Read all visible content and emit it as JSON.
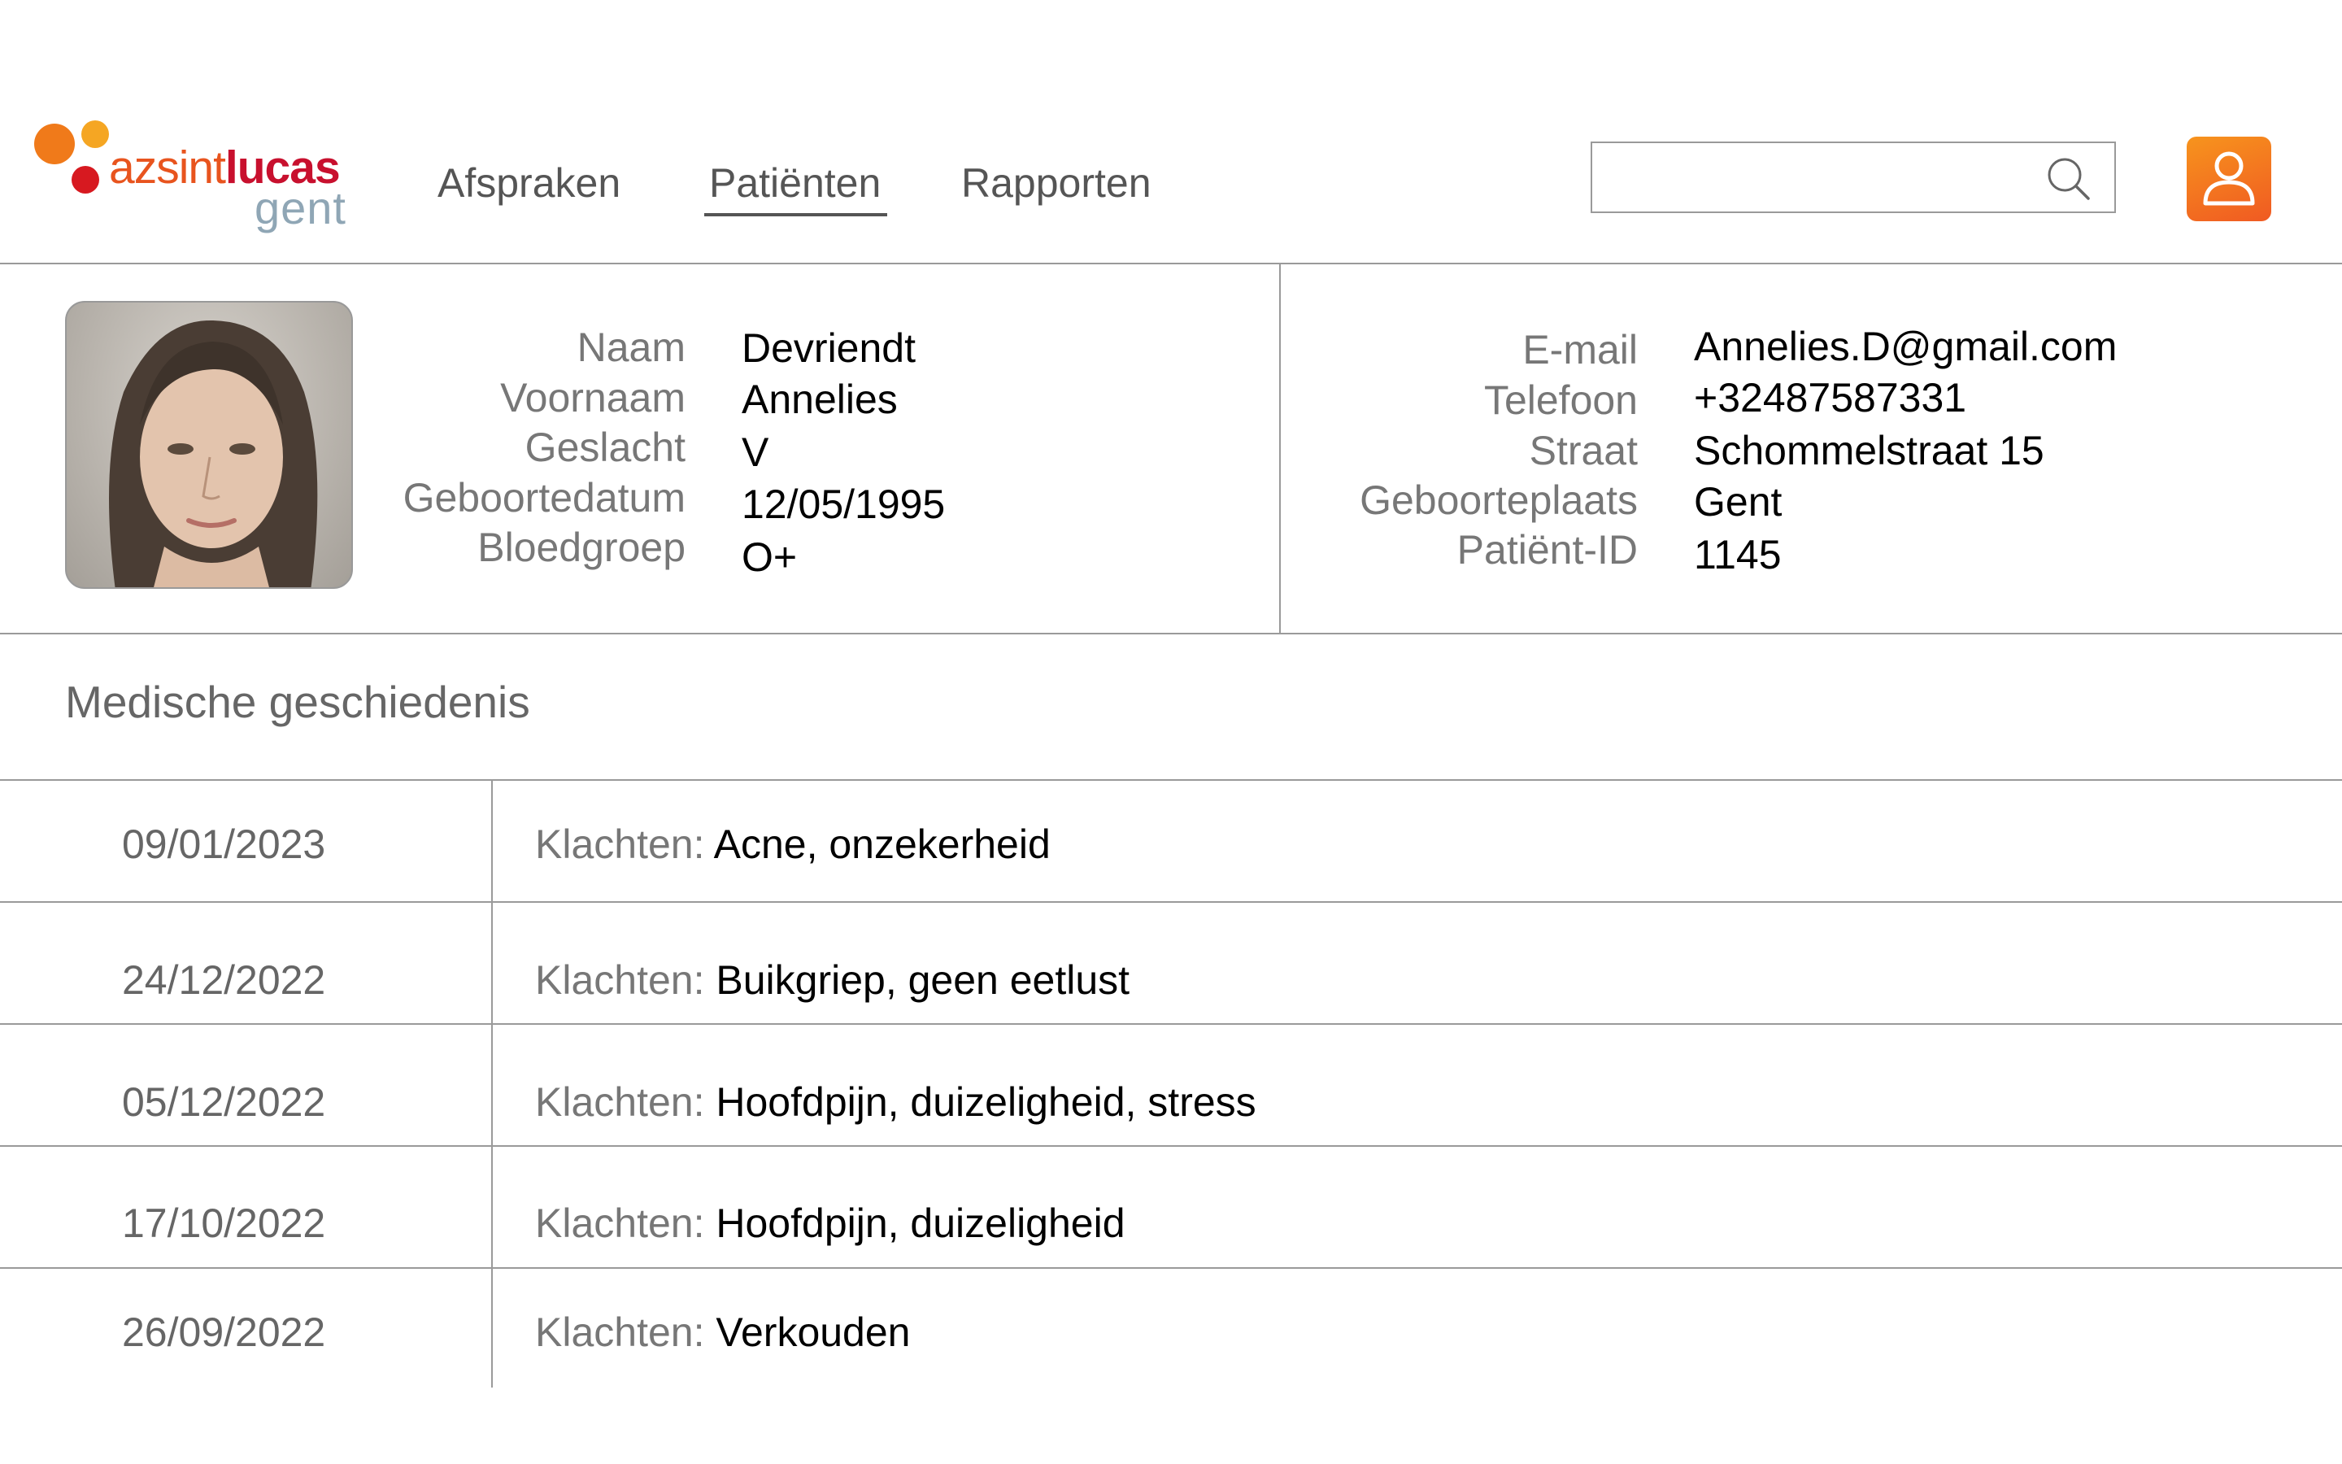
{
  "header": {
    "logo": {
      "part1": "az",
      "part2": "sint",
      "part3": "lucas",
      "city": "gent"
    },
    "nav": [
      {
        "label": "Afspraken",
        "active": false
      },
      {
        "label": "Patiënten",
        "active": true
      },
      {
        "label": "Rapporten",
        "active": false
      }
    ],
    "search": {
      "value": "",
      "placeholder": "",
      "icon": "search-icon"
    },
    "user_icon": "user-icon"
  },
  "patient": {
    "left_labels": [
      "Naam",
      "Voornaam",
      "Geslacht",
      "Geboortedatum",
      "Bloedgroep"
    ],
    "left_values": [
      "Devriendt",
      "Annelies",
      "V",
      "12/05/1995",
      "O+"
    ],
    "right_labels": [
      "E-mail",
      "Telefoon",
      "Straat",
      "Geboorteplaats",
      "Patiënt-ID"
    ],
    "right_values": [
      "Annelies.D@gmail.com",
      "+32487587331",
      "Schommelstraat 15",
      "Gent",
      "1145"
    ]
  },
  "history": {
    "title": "Medische geschiedenis",
    "complaint_label": "Klachten:",
    "rows": [
      {
        "date": "09/01/2023",
        "complaint": "Acne, onzekerheid"
      },
      {
        "date": "24/12/2022",
        "complaint": "Buikgriep, geen eetlust"
      },
      {
        "date": "05/12/2022",
        "complaint": "Hoofdpijn, duizeligheid, stress"
      },
      {
        "date": "17/10/2022",
        "complaint": "Hoofdpijn, duizeligheid"
      },
      {
        "date": "26/09/2022",
        "complaint": "Verkouden"
      }
    ]
  },
  "colors": {
    "accent_orange": "#f7941d",
    "accent_red": "#c8102e",
    "line": "#9a9a9a"
  }
}
